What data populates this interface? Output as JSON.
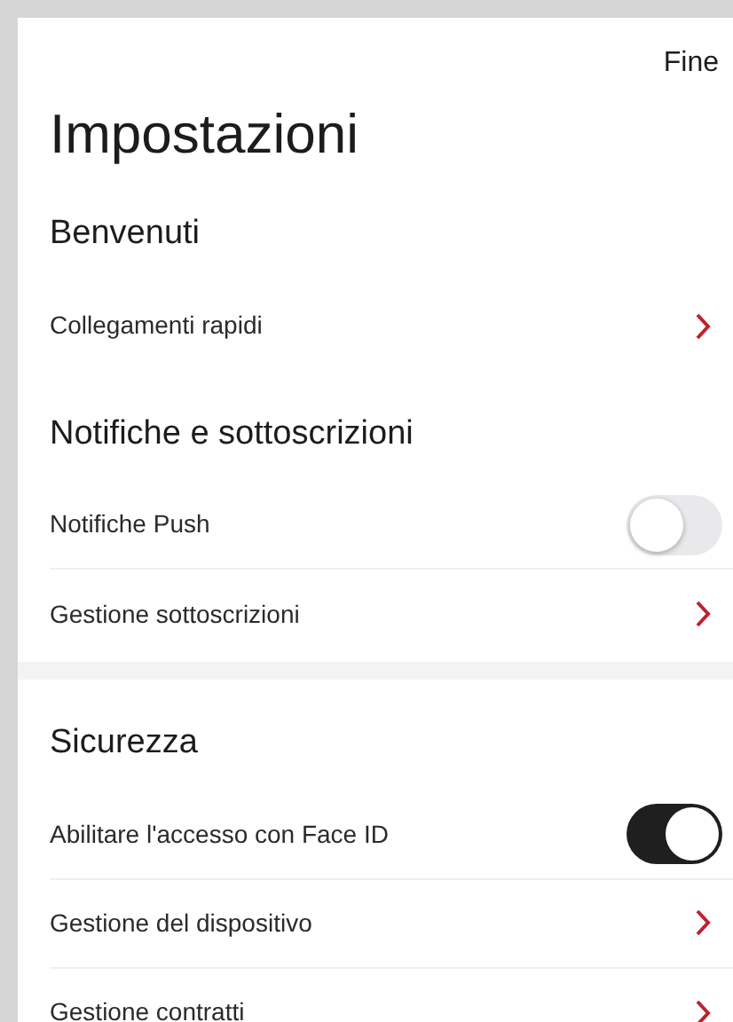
{
  "header": {
    "done_button": "Fine"
  },
  "title": "Impostazioni",
  "sections": [
    {
      "kind": "group",
      "heading": "Benvenuti",
      "items": [
        {
          "label": "Collegamenti rapidi",
          "kind": "link"
        }
      ]
    },
    {
      "kind": "group",
      "heading": "Notifiche e sottoscrizioni",
      "items": [
        {
          "label": "Notifiche Push",
          "kind": "toggle",
          "on": false
        },
        {
          "label": "Gestione sottoscrizioni",
          "kind": "link"
        }
      ]
    },
    {
      "kind": "separator"
    },
    {
      "kind": "group",
      "heading": "Sicurezza",
      "items": [
        {
          "label": "Abilitare l'accesso con Face ID",
          "kind": "toggle",
          "on": true
        },
        {
          "label": "Gestione del dispositivo",
          "kind": "link"
        },
        {
          "label": "Gestione contratti",
          "kind": "link"
        }
      ]
    }
  ]
}
